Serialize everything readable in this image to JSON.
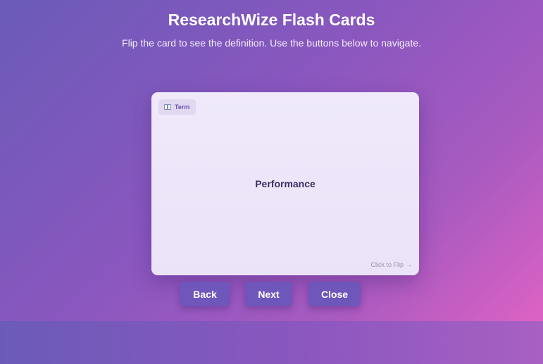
{
  "header": {
    "title": "ResearchWize Flash Cards",
    "subtitle": "Flip the card to see the definition. Use the buttons below to navigate."
  },
  "card": {
    "badge_icon": "book-icon",
    "badge_label": "Term",
    "term": "Performance",
    "flip_hint": "Click to Flip",
    "flip_hint_arrow": "→"
  },
  "buttons": {
    "back": "Back",
    "next": "Next",
    "close": "Close"
  },
  "colors": {
    "background_start": "#6b5bb8",
    "background_end": "#dd62c4",
    "card_background": "#ede6fa",
    "button": "#6e56ba",
    "term_text": "#3b2f63"
  }
}
